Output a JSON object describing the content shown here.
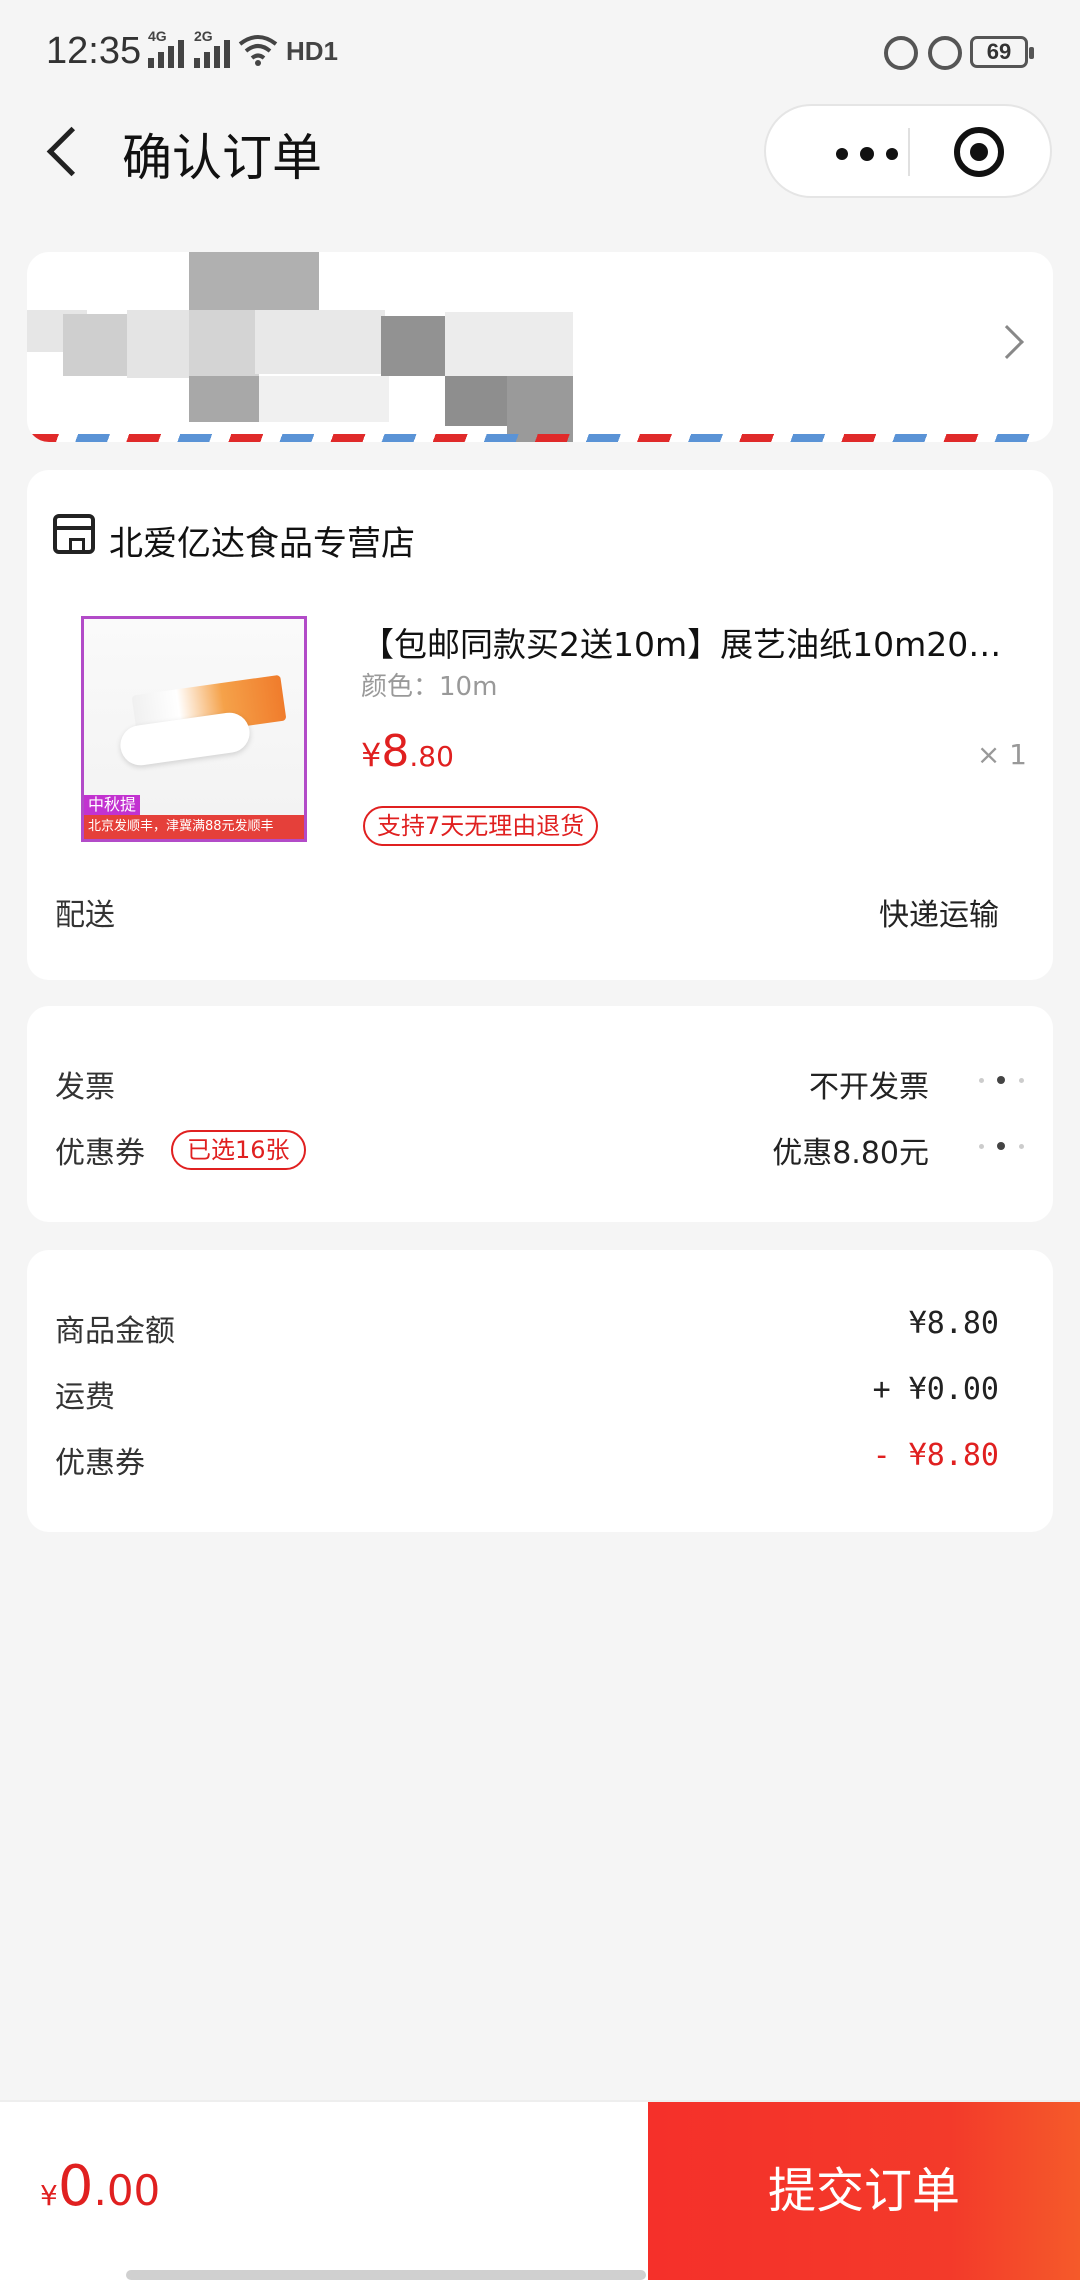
{
  "status_bar": {
    "time": "12:35",
    "sim1_label": "4G",
    "sim2_label": "2G",
    "hd_label": "HD1",
    "battery": "69",
    "icons": [
      "signal-icon",
      "wifi-icon",
      "lock-rotation-icon",
      "alarm-icon",
      "battery-icon"
    ]
  },
  "header": {
    "title": "确认订单",
    "icons": [
      "back-icon",
      "more-icon",
      "target-icon"
    ]
  },
  "store": {
    "name": "北爱亿达食品专营店",
    "product": {
      "title": "【包邮同款买2送10m】展艺油纸10m20…",
      "spec": "颜色：10m",
      "price_symbol": "¥",
      "price_int": "8",
      "price_dec": ".80",
      "quantity": "× 1",
      "return_tag": "支持7天无理由退货",
      "image_badge": "中秋提前购",
      "image_strip": "北京发顺丰，津冀满88元发顺丰"
    },
    "delivery_label": "配送",
    "delivery_value": "快递运输"
  },
  "invoice": {
    "invoice_label": "发票",
    "invoice_value": "不开发票",
    "coupon_label": "优惠券",
    "coupon_badge": "已选16张",
    "coupon_value": "优惠8.80元"
  },
  "summary": {
    "goods_label": "商品金额",
    "goods_value": "¥8.80",
    "shipping_label": "运费",
    "shipping_value": "+ ¥0.00",
    "coupon_label": "优惠券",
    "coupon_value": "- ¥8.80"
  },
  "footer": {
    "total_symbol": "¥",
    "total_int": "0",
    "total_dec": ".00",
    "submit_label": "提交订单"
  },
  "colors": {
    "accent": "#e02020",
    "background": "#f5f5f5"
  }
}
